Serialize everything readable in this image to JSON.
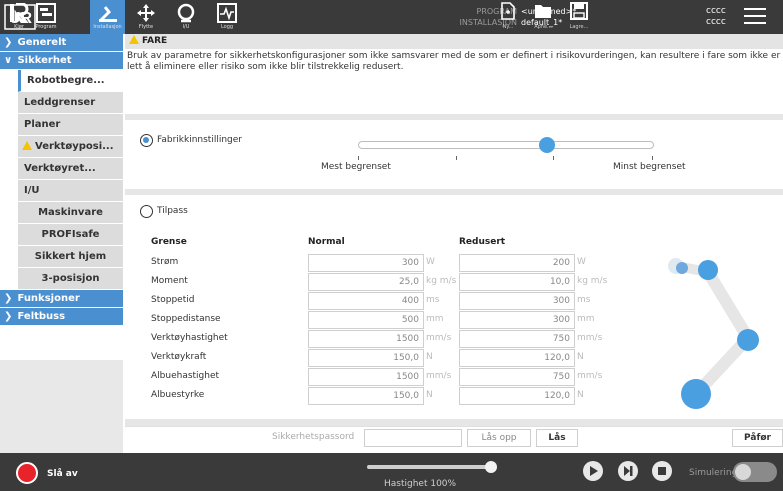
{
  "topbar": {
    "nav": [
      {
        "label": "Kjør",
        "icon": "run-icon"
      },
      {
        "label": "Program",
        "icon": "program-icon"
      },
      {
        "label": "Installasjon",
        "icon": "installation-icon"
      },
      {
        "label": "Flytte",
        "icon": "move-icon"
      },
      {
        "label": "I/U",
        "icon": "io-icon"
      },
      {
        "label": "Logg",
        "icon": "log-icon"
      }
    ],
    "program_key": "PROGRAM",
    "program_value": "<unnamed>*",
    "installation_key": "INSTALLASJON",
    "installation_value": "default_1*",
    "file_buttons": [
      {
        "label": "Ny...",
        "icon": "new-file-icon"
      },
      {
        "label": "Åpne...",
        "icon": "open-folder-icon"
      },
      {
        "label": "Lagre...",
        "icon": "save-icon"
      }
    ],
    "user_line1": "cccc",
    "user_line2": "cccc"
  },
  "sidebar": {
    "generelt": "Generelt",
    "sikkerhet": "Sikkerhet",
    "items": [
      {
        "label": "Robotbegre..."
      },
      {
        "label": "Leddgrenser"
      },
      {
        "label": "Planer"
      },
      {
        "label": "Verktøyposi..."
      },
      {
        "label": "Verktøyret..."
      },
      {
        "label": "I/U"
      },
      {
        "label": "Maskinvare"
      },
      {
        "label": "PROFIsafe"
      },
      {
        "label": "Sikkert hjem"
      },
      {
        "label": "3-posisjon"
      }
    ],
    "funksjoner": "Funksjoner",
    "feltbuss": "Feltbuss"
  },
  "header": {
    "title": "FARE"
  },
  "description": "Bruk av parametre for sikkerhetskonfigurasjoner som ikke samsvarer med de som er definert i risikovurderingen, kan resultere i fare som ikke er lett å eliminere eller risiko som ikke blir tilstrekkelig redusert.",
  "factory": {
    "label": "Fabrikkinnstillinger",
    "slider_left": "Mest begrenset",
    "slider_right": "Minst begrenset",
    "slider_level": 0.64
  },
  "custom": {
    "label": "Tilpass",
    "col_limit": "Grense",
    "col_normal": "Normal",
    "col_reduced": "Redusert",
    "rows": [
      {
        "label": "Strøm",
        "normal": "300",
        "reduced": "200",
        "unit": "W"
      },
      {
        "label": "Moment",
        "normal": "25,0",
        "reduced": "10,0",
        "unit": "kg m/s"
      },
      {
        "label": "Stoppetid",
        "normal": "400",
        "reduced": "300",
        "unit": "ms"
      },
      {
        "label": "Stoppedistanse",
        "normal": "500",
        "reduced": "300",
        "unit": "mm"
      },
      {
        "label": "Verktøyhastighet",
        "normal": "1500",
        "reduced": "750",
        "unit": "mm/s"
      },
      {
        "label": "Verktøykraft",
        "normal": "150,0",
        "reduced": "120,0",
        "unit": "N"
      },
      {
        "label": "Albuehastighet",
        "normal": "1500",
        "reduced": "750",
        "unit": "mm/s"
      },
      {
        "label": "Albuestyrke",
        "normal": "150,0",
        "reduced": "120,0",
        "unit": "N"
      }
    ]
  },
  "password": {
    "label": "Sikkerhetspassord",
    "unlock": "Lås opp",
    "lock": "Lås",
    "apply": "Påfør"
  },
  "footer": {
    "power": "Slå av",
    "speed": "Hastighet 100%",
    "speed_level": 1.0,
    "simulation": "Simulering"
  },
  "colors": {
    "accent": "#4a8fd0",
    "topbar": "#3a3a3a",
    "warning": "#f5c400",
    "power": "#e8232a"
  }
}
